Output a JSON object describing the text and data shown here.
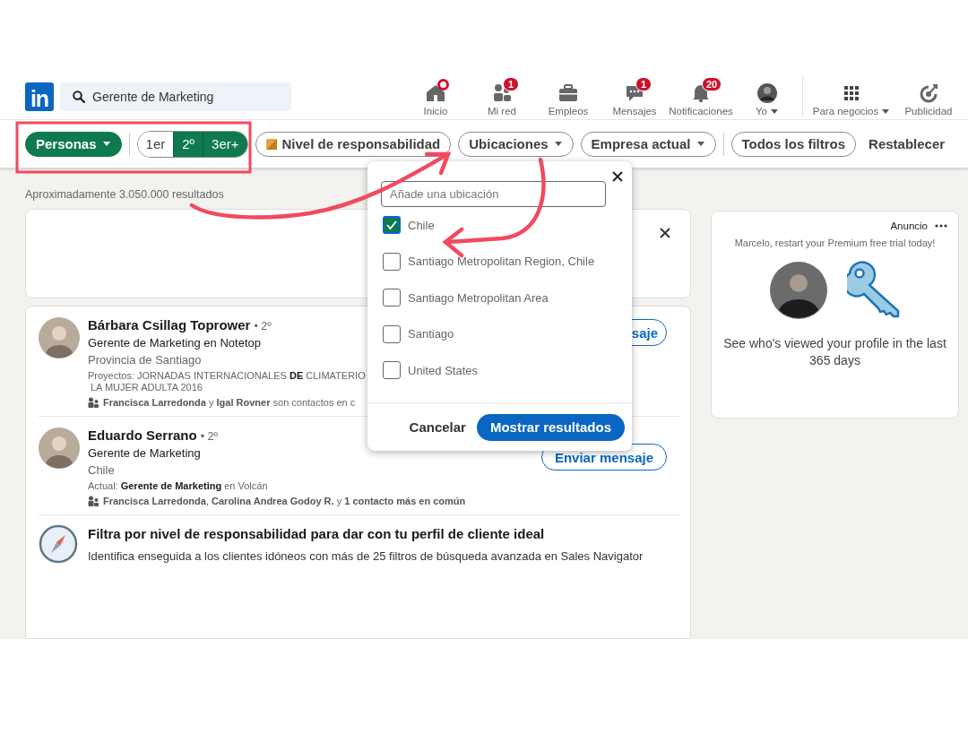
{
  "navbar": {
    "logo": "in",
    "search": {
      "value": "Gerente de Marketing"
    },
    "items": [
      {
        "label": "Inicio",
        "dot": true
      },
      {
        "label": "Mi red",
        "badge": "1"
      },
      {
        "label": "Empleos"
      },
      {
        "label": "Mensajes",
        "badge": "1"
      },
      {
        "label": "Notificaciones",
        "badge": "20"
      },
      {
        "label": "Yo",
        "dropdown": true
      }
    ],
    "business_items": [
      {
        "label": "Para negocios",
        "dropdown": true
      },
      {
        "label": "Publicidad"
      }
    ]
  },
  "filters": {
    "type_filter": {
      "label": "Personas",
      "selected": true
    },
    "degrees": [
      {
        "label": "1er",
        "selected": false
      },
      {
        "label": "2º",
        "selected": true
      },
      {
        "label": "3er+",
        "selected": true
      }
    ],
    "pills": [
      {
        "label": "Nivel de responsabilidad",
        "premium": true
      },
      {
        "label": "Ubicaciones",
        "dropdown": true
      },
      {
        "label": "Empresa actual",
        "dropdown": true
      }
    ],
    "all_filters": "Todos los filtros",
    "reset": "Restablecer"
  },
  "results_count": "Aproximadamente 3.050.000 resultados",
  "people": [
    {
      "name": "Bárbara Csillag Toprower",
      "degree": "• 2º",
      "headline": "Gerente de Marketing en Notetop",
      "location": "Provincia de Santiago",
      "summary_lines": [
        "Proyectos: JORNADAS INTERNACIONALES **DE** CLIMATERIO",
        "LA MUJER ADULTA 2016"
      ],
      "connections": "**Francisca Larredonda** y **Igal Rovner** son contactos en c",
      "button": "saje"
    },
    {
      "name": "Eduardo Serrano",
      "degree": "• 2º",
      "headline": "Gerente de Marketing",
      "location": "Chile",
      "summary_lines": [
        "Actual: **Gerente de Marketing** en Volcán"
      ],
      "connections": "**Francisca Larredonda**, **Carolina Andrea Godoy R.** y **1 contacto más en común**",
      "button": "Enviar mensaje"
    }
  ],
  "promo": {
    "title": "Filtra por nivel de responsabilidad para dar con tu perfil de cliente ideal",
    "text": "Identifica enseguida a los clientes idóneos con más de 25 filtros de búsqueda avanzada en Sales Navigator"
  },
  "ad": {
    "label": "Anuncio",
    "headline": "Marcelo, restart your Premium free trial today!",
    "text": "See who's viewed your profile in the last 365 days"
  },
  "location_filter": {
    "placeholder": "Añade una ubicación",
    "options": [
      {
        "label": "Chile",
        "checked": true
      },
      {
        "label": "Santiago Metropolitan Region, Chile",
        "checked": false
      },
      {
        "label": "Santiago Metropolitan Area",
        "checked": false
      },
      {
        "label": "Santiago",
        "checked": false
      },
      {
        "label": "United States",
        "checked": false
      }
    ],
    "cancel": "Cancelar",
    "apply": "Mostrar resultados"
  }
}
